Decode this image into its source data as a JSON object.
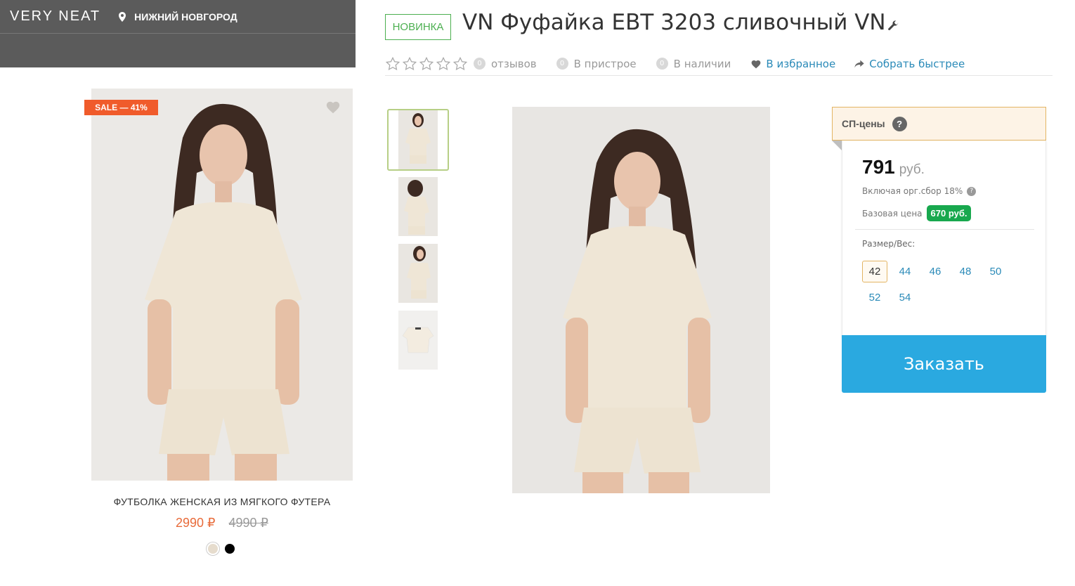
{
  "brand": {
    "logo": "VERY NEAT",
    "location": "НИЖНИЙ НОВГОРОД"
  },
  "card": {
    "sale_badge": "SALE — 41%",
    "title": "ФУТБОЛКА ЖЕНСКАЯ ИЗ МЯГКОГО ФУТЕРА",
    "price_new": "2990 ₽",
    "price_old": "4990 ₽",
    "swatches": [
      "cream",
      "black"
    ]
  },
  "product": {
    "badge": "НОВИНКА",
    "title": "VN Фуфайка ЕВТ 3203 сливочный VN",
    "rating": 0,
    "reviews_count": "0",
    "reviews_label": "отзывов",
    "pristroy_count": "0",
    "pristroy_label": "В пристрое",
    "stock_count": "0",
    "stock_label": "В наличии",
    "favorite_label": "В избранное",
    "collect_label": "Собрать быстрее"
  },
  "thumbnails": [
    "front",
    "side-hair",
    "side",
    "flat-lay"
  ],
  "price_panel": {
    "header": "СП-цены",
    "help": "?",
    "price": "791",
    "currency": "руб.",
    "fee_text": "Включая орг.сбор 18%",
    "base_label": "Базовая цена",
    "base_price": "670 руб.",
    "size_label": "Размер/Вес:",
    "sizes": [
      "42",
      "44",
      "46",
      "48",
      "50",
      "52",
      "54"
    ],
    "selected_size": "42",
    "order_button": "Заказать"
  },
  "colors": {
    "accent": "#2aa9e0",
    "sale": "#f05b2b",
    "new_badge": "#4caf50",
    "base_price_bg": "#18a84e",
    "link": "#2a8ab8"
  }
}
